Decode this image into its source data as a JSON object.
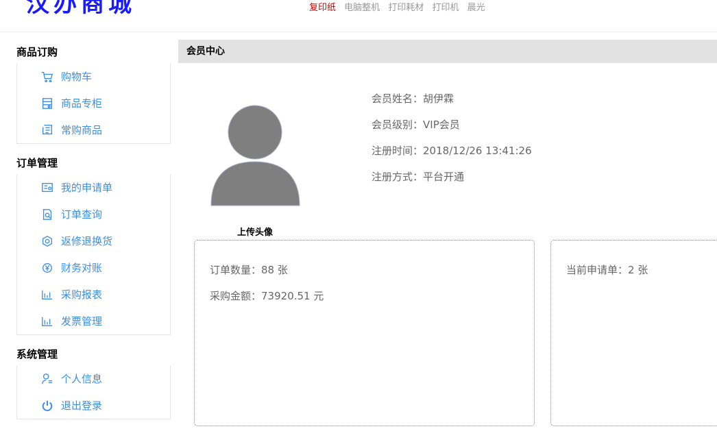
{
  "header": {
    "logo": "汉办商城",
    "hot_words": [
      "复印纸",
      "电脑整机",
      "打印耗材",
      "打印机",
      "晨光"
    ]
  },
  "sidebar": {
    "sections": [
      {
        "title": "商品订购",
        "items": [
          {
            "label": "购物车",
            "icon": "cart-icon"
          },
          {
            "label": "商品专柜",
            "icon": "counter-icon"
          },
          {
            "label": "常购商品",
            "icon": "list-icon"
          }
        ]
      },
      {
        "title": "订单管理",
        "items": [
          {
            "label": "我的申请单",
            "icon": "application-icon"
          },
          {
            "label": "订单查询",
            "icon": "order-search-icon"
          },
          {
            "label": "返修退换货",
            "icon": "return-icon"
          },
          {
            "label": "财务对账",
            "icon": "finance-icon"
          },
          {
            "label": "采购报表",
            "icon": "bar-chart-icon"
          },
          {
            "label": "发票管理",
            "icon": "invoice-chart-icon"
          }
        ]
      },
      {
        "title": "系统管理",
        "items": [
          {
            "label": "个人信息",
            "icon": "user-icon"
          },
          {
            "label": "退出登录",
            "icon": "power-icon"
          }
        ]
      }
    ]
  },
  "main": {
    "title": "会员中心",
    "upload_label": "上传头像",
    "member_info": [
      {
        "label": "会员姓名：",
        "value": "胡伊霖"
      },
      {
        "label": "会员级别：",
        "value": "VIP会员"
      },
      {
        "label": "注册时间：",
        "value": "2018/12/26 13:41:26"
      },
      {
        "label": "注册方式：",
        "value": "平台开通"
      }
    ],
    "order_card": {
      "count_label": "订单数量：",
      "count_value": "88 张",
      "amount_label": "采购金额：",
      "amount_value": "73920.51 元"
    },
    "application_card": {
      "label": "当前申请单：",
      "value": "2 张"
    }
  },
  "colors": {
    "accent": "#3a8ee6",
    "hot": "#cc0000",
    "logo": "#1a1aff",
    "title_bar": "#e2e2e2"
  }
}
